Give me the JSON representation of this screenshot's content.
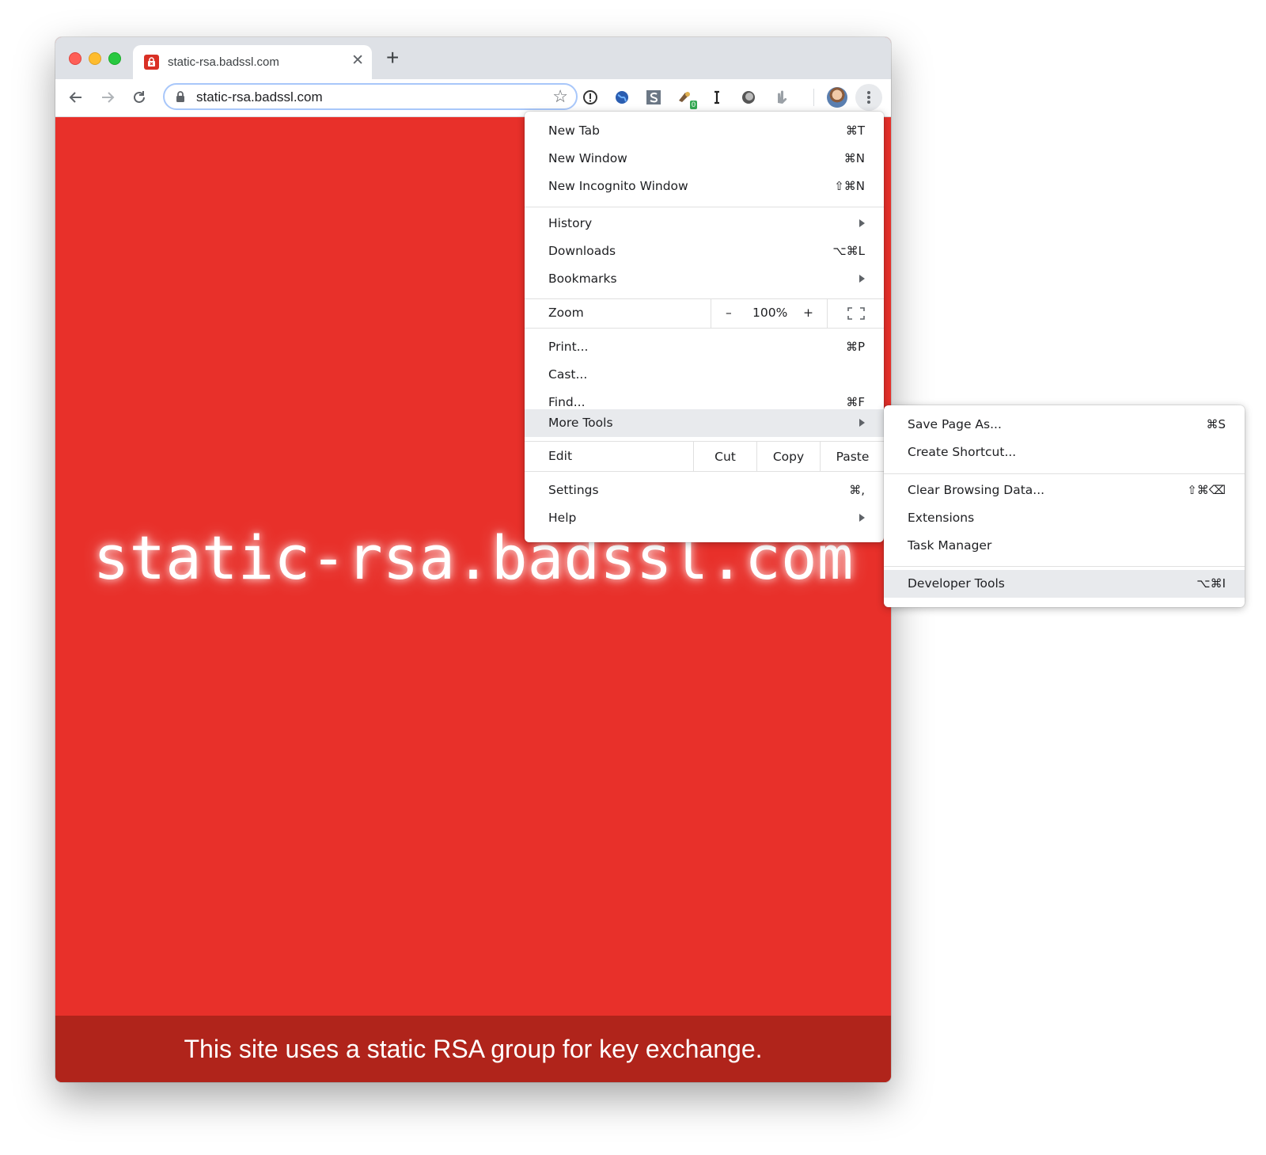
{
  "browser": {
    "tab_title": "static-rsa.badssl.com",
    "url": "static-rsa.badssl.com",
    "extensions": [
      {
        "icon": "info-icon"
      },
      {
        "icon": "globe-icon"
      },
      {
        "icon": "square-s-icon"
      },
      {
        "icon": "cursor-extension-icon",
        "badge": "0"
      },
      {
        "icon": "serif-i-icon"
      },
      {
        "icon": "circle-icon"
      },
      {
        "icon": "hand-icon"
      }
    ]
  },
  "page": {
    "domain_heading": "static-rsa.badssl.com",
    "footer_text": "This site uses a static RSA group for key exchange.",
    "background_color": "#e8302a",
    "footer_color": "#b0241b"
  },
  "menu": {
    "items": [
      {
        "label": "New Tab",
        "shortcut": "⌘T"
      },
      {
        "label": "New Window",
        "shortcut": "⌘N"
      },
      {
        "label": "New Incognito Window",
        "shortcut": "⇧⌘N"
      },
      {
        "label": "History"
      },
      {
        "label": "Downloads",
        "shortcut": "⌥⌘L"
      },
      {
        "label": "Bookmarks"
      },
      {
        "label": "Print...",
        "shortcut": "⌘P"
      },
      {
        "label": "Cast..."
      },
      {
        "label": "Find...",
        "shortcut": "⌘F"
      },
      {
        "label": "More Tools"
      },
      {
        "label": "Settings",
        "shortcut": "⌘,"
      },
      {
        "label": "Help"
      }
    ],
    "zoom": {
      "label": "Zoom",
      "minus": "–",
      "value": "100%",
      "plus": "+"
    },
    "edit": {
      "label": "Edit",
      "cut": "Cut",
      "copy": "Copy",
      "paste": "Paste"
    }
  },
  "submenu": {
    "items": [
      {
        "label": "Save Page As...",
        "shortcut": "⌘S"
      },
      {
        "label": "Create Shortcut..."
      },
      {
        "label": "Clear Browsing Data...",
        "shortcut": "⇧⌘⌫"
      },
      {
        "label": "Extensions"
      },
      {
        "label": "Task Manager"
      },
      {
        "label": "Developer Tools",
        "shortcut": "⌥⌘I"
      }
    ]
  }
}
